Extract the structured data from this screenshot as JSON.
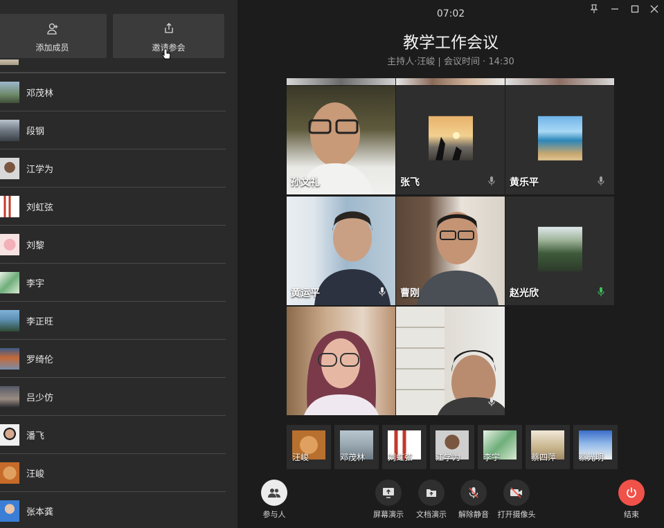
{
  "sidebar": {
    "add_member_label": "添加成员",
    "invite_label": "邀请参会",
    "members": [
      {
        "name": "邓茂林"
      },
      {
        "name": "段钢"
      },
      {
        "name": "江学为"
      },
      {
        "name": "刘虹弦"
      },
      {
        "name": "刘黎"
      },
      {
        "name": "李宇"
      },
      {
        "name": "李正旺"
      },
      {
        "name": "罗绮伦"
      },
      {
        "name": "吕少仿"
      },
      {
        "name": "潘飞"
      },
      {
        "name": "汪峻"
      },
      {
        "name": "张本龚"
      }
    ]
  },
  "header": {
    "time": "07:02",
    "title": "教学工作会议",
    "subtitle": "主持人·汪峻 | 会议时间 · 14:30"
  },
  "video_grid": [
    {
      "name": "孙文礼"
    },
    {
      "name": "张飞"
    },
    {
      "name": "黄乐平"
    },
    {
      "name": "黄运平"
    },
    {
      "name": "曹刚"
    },
    {
      "name": "赵光欣"
    },
    {
      "name": ""
    },
    {
      "name": ""
    }
  ],
  "thumbnails": [
    {
      "name": "汪峻"
    },
    {
      "name": "邓茂林"
    },
    {
      "name": "刘虹弦"
    },
    {
      "name": "江学为"
    },
    {
      "name": "李宇"
    },
    {
      "name": "蔡四萍"
    },
    {
      "name": "蔡光明"
    }
  ],
  "toolbar": {
    "participants": "参与人",
    "screen_share": "屏幕演示",
    "doc_share": "文档演示",
    "unmute": "解除静音",
    "camera": "打开摄像头",
    "end": "结束"
  },
  "colors": {
    "end_button": "#f0524a",
    "mic_active": "#3cc05a"
  }
}
